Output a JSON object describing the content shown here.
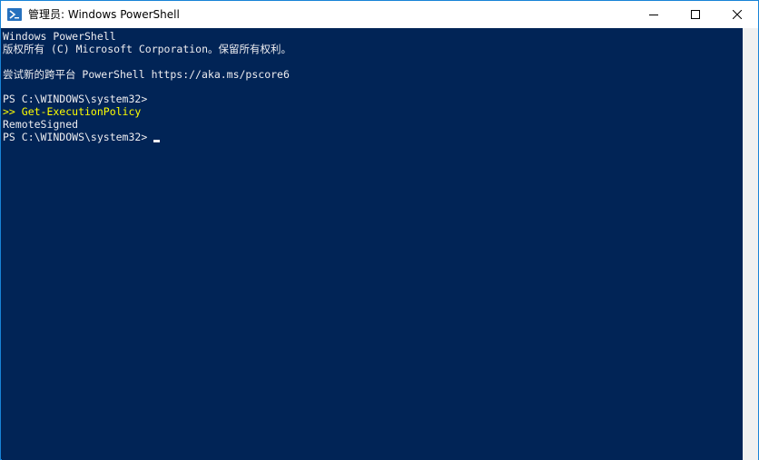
{
  "window": {
    "title": "管理员: Windows PowerShell",
    "icon": "powershell-icon",
    "controls": {
      "minimize": "minimize-icon",
      "maximize": "maximize-icon",
      "close": "close-icon"
    }
  },
  "console": {
    "background": "#012456",
    "foreground": "#eeedf0",
    "command_color": "#ffff00",
    "lines": [
      "Windows PowerShell",
      "版权所有 (C) Microsoft Corporation。保留所有权利。",
      "",
      "尝试新的跨平台 PowerShell https://aka.ms/pscore6",
      "",
      "PS C:\\WINDOWS\\system32>",
      ">> Get-ExecutionPolicy",
      "RemoteSigned",
      "PS C:\\WINDOWS\\system32>"
    ]
  }
}
